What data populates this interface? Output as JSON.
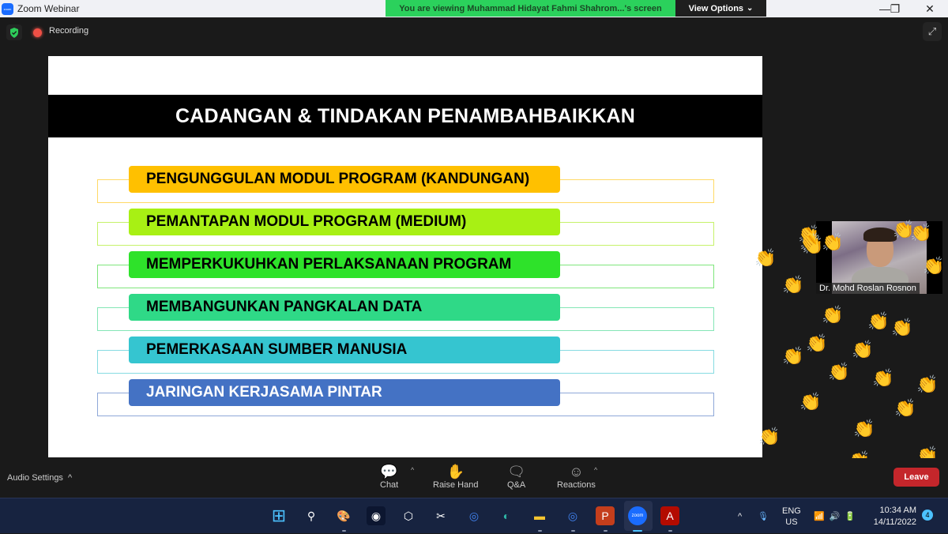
{
  "window": {
    "title": "Zoom Webinar",
    "logo_text": "zoom",
    "controls": {
      "minimize": "—",
      "restore": "❐",
      "close": "✕"
    }
  },
  "share_banner": {
    "text": "You are viewing Muhammad Hidayat Fahmi Shahrom...'s screen",
    "view_options_label": "View Options",
    "view_options_caret": "⌄",
    "color": "#2bd15c"
  },
  "meeting_status": {
    "security_icon": "shield-check-icon",
    "recording_label": "Recording",
    "fullscreen_glyph": "⤢"
  },
  "slide": {
    "title": "CADANGAN & TINDAKAN PENAMBAHBAIKKAN",
    "items": [
      {
        "label": "PENGUNGGULAN MODUL PROGRAM (KANDUNGAN)",
        "fill": "#ffc000",
        "outline": "#ffd966",
        "text_color": "#000000"
      },
      {
        "label": "PEMANTAPAN MODUL PROGRAM (MEDIUM)",
        "fill": "#a8f014",
        "outline": "#c6f26a",
        "text_color": "#000000"
      },
      {
        "label": "MEMPERKUKUHKAN PERLAKSANAAN PROGRAM",
        "fill": "#2ee22a",
        "outline": "#7fe67c",
        "text_color": "#000000"
      },
      {
        "label": "MEMBANGUNKAN PANGKALAN DATA",
        "fill": "#2fd987",
        "outline": "#84e6b6",
        "text_color": "#000000"
      },
      {
        "label": "PEMERKASAAN SUMBER MANUSIA",
        "fill": "#35c5d0",
        "outline": "#86dbe1",
        "text_color": "#000000"
      },
      {
        "label": "JARINGAN KERJASAMA PINTAR",
        "fill": "#4472c4",
        "outline": "#8ea7d8",
        "text_color": "#ffffff"
      }
    ]
  },
  "participant_video": {
    "name": "Dr. Mohd Roslan Rosnon"
  },
  "reactions": {
    "emoji": "👏",
    "count_visible": 24
  },
  "toolbar": {
    "audio_settings_label": "Audio Settings",
    "audio_caret": "^",
    "buttons": [
      {
        "label": "Chat",
        "icon": "💬",
        "has_caret": true
      },
      {
        "label": "Raise Hand",
        "icon": "✋",
        "has_caret": false
      },
      {
        "label": "Q&A",
        "icon": "🗨",
        "has_caret": false
      },
      {
        "label": "Reactions",
        "icon": "☺",
        "has_caret": true
      }
    ],
    "caret_glyph": "^",
    "leave_label": "Leave",
    "leave_color": "#c4262b"
  },
  "taskbar": {
    "apps": [
      {
        "name": "start",
        "glyph": "⊞"
      },
      {
        "name": "search",
        "glyph": "⚲"
      },
      {
        "name": "paint",
        "glyph": "🎨"
      },
      {
        "name": "webcam-app",
        "glyph": "◉"
      },
      {
        "name": "3d-viewer",
        "glyph": "⬡"
      },
      {
        "name": "snipping-tool",
        "glyph": "✂"
      },
      {
        "name": "chrome",
        "glyph": "◎"
      },
      {
        "name": "edge",
        "glyph": "◐"
      },
      {
        "name": "file-explorer",
        "glyph": "▬"
      },
      {
        "name": "chrome-profile",
        "glyph": "◎"
      },
      {
        "name": "powerpoint",
        "glyph": "P"
      },
      {
        "name": "zoom",
        "glyph": "zoom"
      },
      {
        "name": "acrobat",
        "glyph": "A"
      }
    ],
    "tray": {
      "overflow_glyph": "^",
      "mic_glyph": "🎙",
      "language_line1": "ENG",
      "language_line2": "US",
      "wifi_glyph": "📶",
      "volume_glyph": "🔊",
      "battery_glyph": "🔋",
      "time": "10:34 AM",
      "date": "14/11/2022",
      "notification_count": "4"
    }
  }
}
